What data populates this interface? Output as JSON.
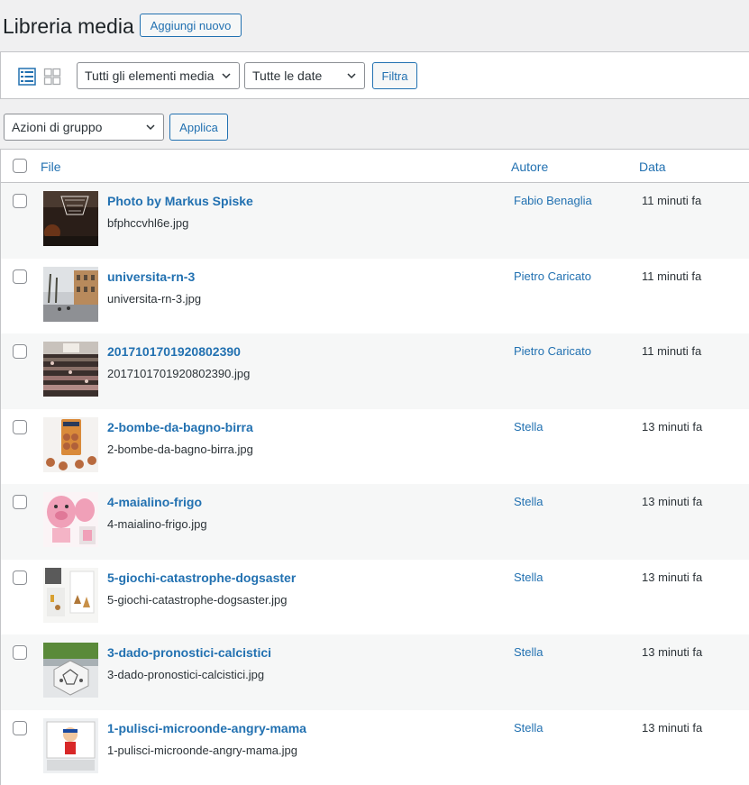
{
  "header": {
    "title": "Libreria media",
    "add_new_label": "Aggiungi nuovo"
  },
  "toolbar": {
    "list_view_icon": "list-view-icon",
    "grid_view_icon": "grid-view-icon",
    "type_filter_value": "Tutti gli elementi media",
    "date_filter_value": "Tutte le date",
    "filter_button_label": "Filtra"
  },
  "bulk": {
    "actions_value": "Azioni di gruppo",
    "apply_label": "Applica"
  },
  "table": {
    "columns": {
      "file": "File",
      "author": "Autore",
      "date": "Data"
    },
    "rows": [
      {
        "title": "Photo by Markus Spiske",
        "filename": "bfphccvhl6e.jpg",
        "author": "Fabio Benaglia",
        "date": "11 minuti fa",
        "thumb": "basketball-photo"
      },
      {
        "title": "universita-rn-3",
        "filename": "universita-rn-3.jpg",
        "author": "Pietro Caricato",
        "date": "11 minuti fa",
        "thumb": "building-photo"
      },
      {
        "title": "2017101701920802390",
        "filename": "2017101701920802390.jpg",
        "author": "Pietro Caricato",
        "date": "11 minuti fa",
        "thumb": "classroom-photo"
      },
      {
        "title": "2-bombe-da-bagno-birra",
        "filename": "2-bombe-da-bagno-birra.jpg",
        "author": "Stella",
        "date": "13 minuti fa",
        "thumb": "bath-bombs-photo"
      },
      {
        "title": "4-maialino-frigo",
        "filename": "4-maialino-frigo.jpg",
        "author": "Stella",
        "date": "13 minuti fa",
        "thumb": "pig-fridge-photo"
      },
      {
        "title": "5-giochi-catastrophe-dogsaster",
        "filename": "5-giochi-catastrophe-dogsaster.jpg",
        "author": "Stella",
        "date": "13 minuti fa",
        "thumb": "game-box-photo"
      },
      {
        "title": "3-dado-pronostici-calcistici",
        "filename": "3-dado-pronostici-calcistici.jpg",
        "author": "Stella",
        "date": "13 minuti fa",
        "thumb": "dice-photo"
      },
      {
        "title": "1-pulisci-microonde-angry-mama",
        "filename": "1-pulisci-microonde-angry-mama.jpg",
        "author": "Stella",
        "date": "13 minuti fa",
        "thumb": "angry-mama-photo"
      }
    ]
  },
  "colors": {
    "accent": "#2271b1",
    "background": "#f0f0f1",
    "row_alt": "#f6f7f7",
    "border": "#c3c4c7"
  }
}
